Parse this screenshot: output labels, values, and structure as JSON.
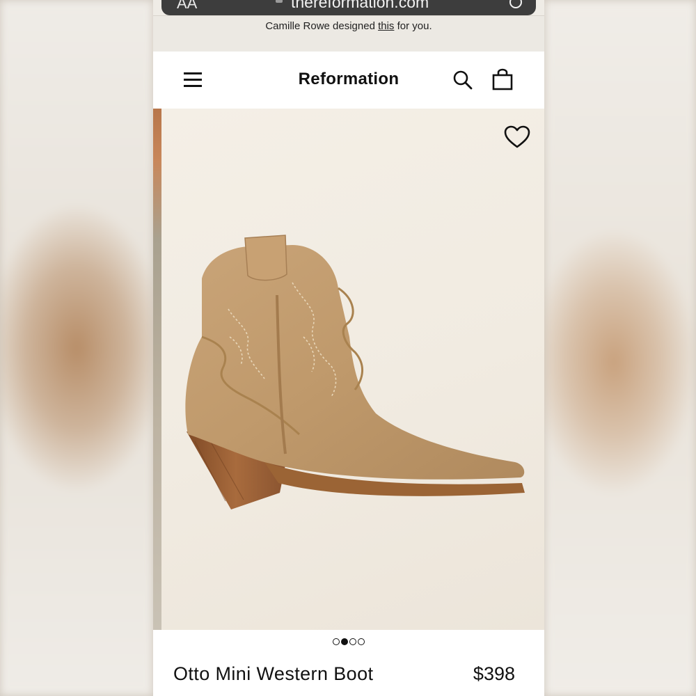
{
  "browser": {
    "aa_label": "AA",
    "url": "thereformation.com"
  },
  "promo": {
    "prefix": "Camille Rowe designed ",
    "link": "this",
    "suffix": " for you."
  },
  "header": {
    "brand": "Reformation",
    "icons": [
      "menu-icon",
      "search-icon",
      "bag-icon"
    ]
  },
  "product": {
    "name": "Otto Mini Western Boot",
    "price": "$398",
    "image": "tan suede western ankle boot",
    "favorite_icon": "heart-outline-icon",
    "carousel": {
      "total": 4,
      "active_index": 1
    }
  },
  "colors": {
    "text": "#111111",
    "header_bg": "#ffffff",
    "gallery_bg": "#f2ece3",
    "suede": "#c09a6e",
    "heel": "#9a5f33",
    "urlbar": "#3d3d3d"
  }
}
